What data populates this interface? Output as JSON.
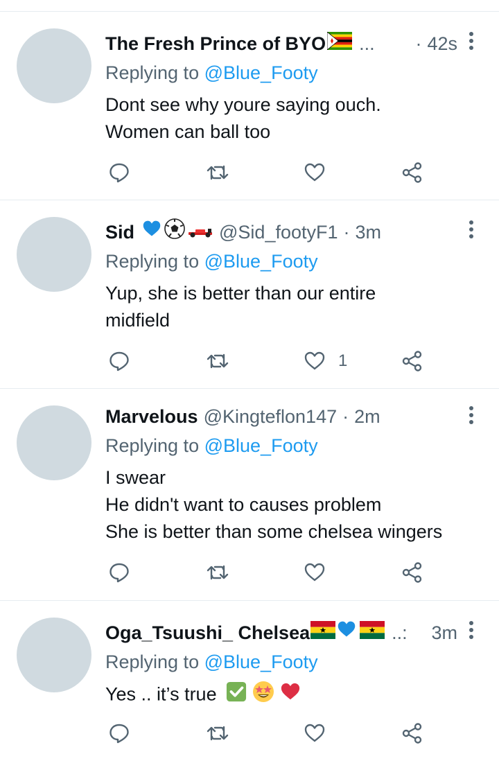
{
  "colors": {
    "accent": "#1d9bf0",
    "secondary_text": "#536471",
    "divider": "#e6ecf0",
    "avatar_placeholder": "#d0dae0"
  },
  "tweets": [
    {
      "display_name": "The Fresh Prince of BYO",
      "name_emoji": "zimbabwe-flag",
      "handle": "",
      "truncated": "...",
      "time": "42s",
      "reply_prefix": "Replying to",
      "reply_to": "@Blue_Footy",
      "text_lines": [
        "Dont see why youre saying ouch.",
        "Women can ball too"
      ],
      "like_count": ""
    },
    {
      "display_name": "Sid",
      "name_emoji": "blue-heart soccer-ball race-car",
      "handle": "@Sid_footyF1",
      "truncated": "",
      "time": "3m",
      "reply_prefix": "Replying to",
      "reply_to": "@Blue_Footy",
      "text_lines": [
        "Yup, she is better than our entire",
        "midfield"
      ],
      "like_count": "1"
    },
    {
      "display_name": "Marvelous",
      "name_emoji": "",
      "handle": "@Kingteflon147",
      "truncated": "",
      "time": "2m",
      "reply_prefix": "Replying to",
      "reply_to": "@Blue_Footy",
      "text_lines": [
        "I swear",
        "He didn't want to causes problem",
        "She is better than some chelsea wingers"
      ],
      "like_count": ""
    },
    {
      "display_name": "Oga_Tsuushi_ Chelsea",
      "name_emoji": "ghana-flag blue-heart ghana-flag",
      "handle": "",
      "truncated": "..:",
      "time": "3m",
      "reply_prefix": "Replying to",
      "reply_to": "@Blue_Footy",
      "text_lines": [
        "Yes .. it’s true"
      ],
      "text_emoji": "check-mark star-struck red-heart",
      "like_count": ""
    }
  ]
}
